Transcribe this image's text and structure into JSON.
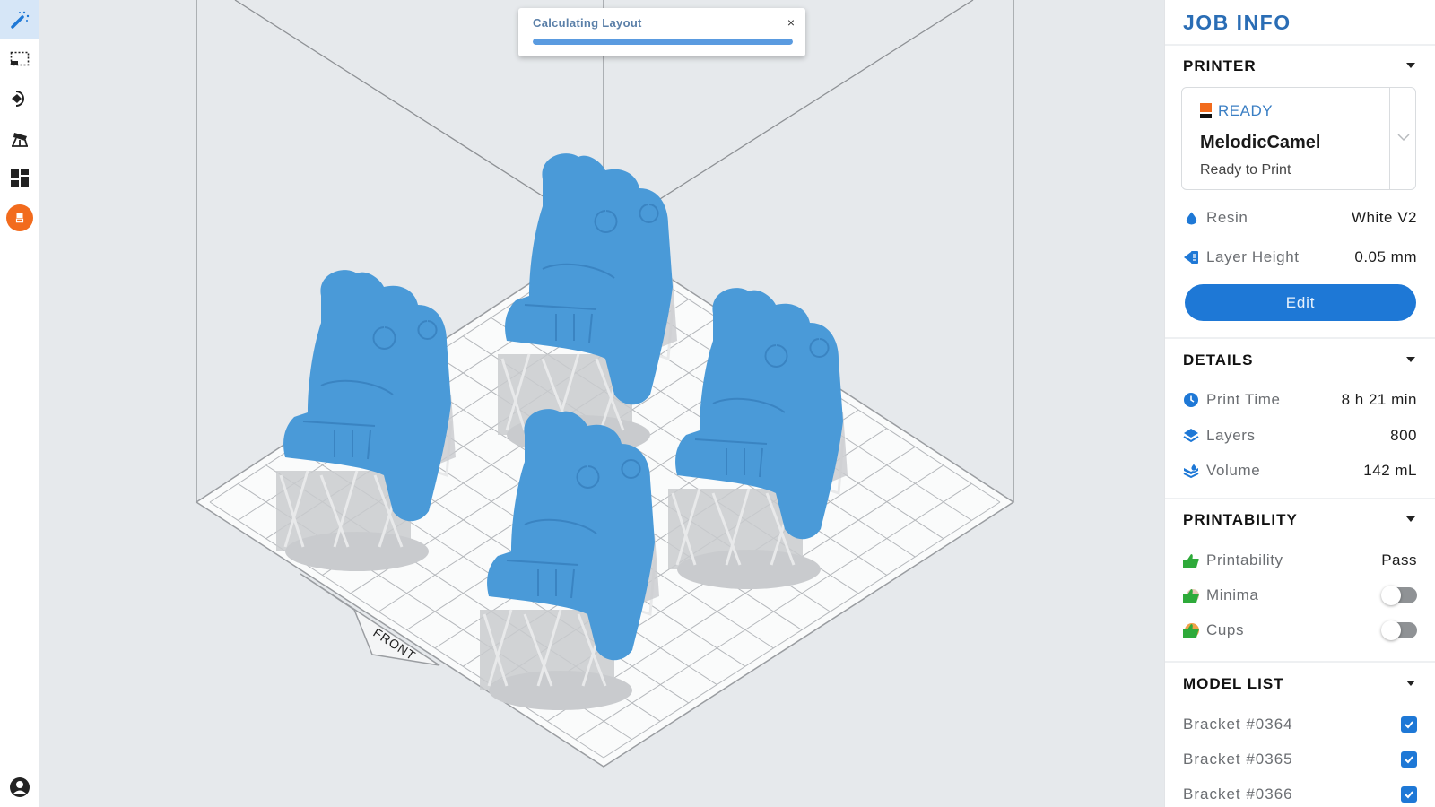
{
  "toolbar": {
    "tools": [
      {
        "id": "auto-setup",
        "icon": "magic-wand-icon",
        "active": true
      },
      {
        "id": "select",
        "icon": "selection-box-icon",
        "active": false
      },
      {
        "id": "orient",
        "icon": "rotate-orient-icon",
        "active": false
      },
      {
        "id": "supports",
        "icon": "supports-icon",
        "active": false
      },
      {
        "id": "layout",
        "icon": "layout-grid-icon",
        "active": false
      },
      {
        "id": "print",
        "icon": "print-job-icon",
        "active": false
      }
    ],
    "account_icon": "account-icon"
  },
  "toast": {
    "title": "Calculating Layout",
    "close": "×",
    "progress": 1.0
  },
  "viewport": {
    "front_label": "FRONT",
    "model_color": "#4a9ad8",
    "support_color": "#c9cbce"
  },
  "panel": {
    "title": "JOB INFO",
    "printer": {
      "heading": "PRINTER",
      "status": "READY",
      "name": "MelodicCamel",
      "substatus": "Ready to Print",
      "resin_label": "Resin",
      "resin_value": "White V2",
      "layer_height_label": "Layer Height",
      "layer_height_value": "0.05 mm",
      "edit_label": "Edit"
    },
    "details": {
      "heading": "DETAILS",
      "print_time_label": "Print Time",
      "print_time_value": "8 h 21 min",
      "layers_label": "Layers",
      "layers_value": "800",
      "volume_label": "Volume",
      "volume_value": "142 mL"
    },
    "printability": {
      "heading": "PRINTABILITY",
      "printability_label": "Printability",
      "printability_value": "Pass",
      "minima_label": "Minima",
      "minima_on": false,
      "cups_label": "Cups",
      "cups_on": false
    },
    "model_list": {
      "heading": "MODEL LIST",
      "items": [
        {
          "name": "Bracket #0364",
          "checked": true
        },
        {
          "name": "Bracket #0365",
          "checked": true
        },
        {
          "name": "Bracket #0366",
          "checked": true
        }
      ]
    }
  },
  "colors": {
    "accent": "#1e78d6",
    "title_blue": "#2a6db5",
    "status_orange": "#f26b1d",
    "pass_green": "#2eaa3a"
  }
}
